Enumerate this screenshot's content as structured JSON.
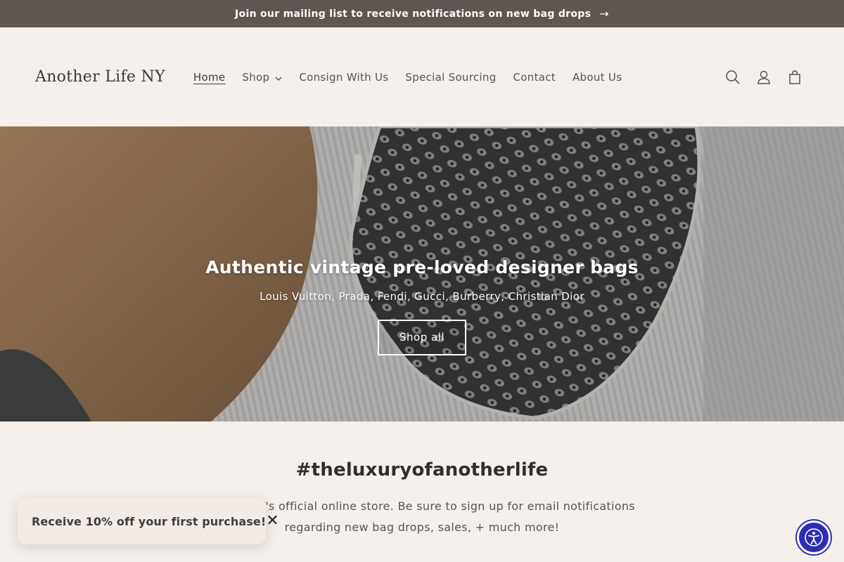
{
  "announcement": {
    "text": "Join our mailing list to receive notifications on new bag drops",
    "arrow": "→"
  },
  "header": {
    "logo": "Another Life NY",
    "nav": [
      {
        "label": "Home",
        "active": true
      },
      {
        "label": "Shop",
        "has_dropdown": true
      },
      {
        "label": "Consign With Us"
      },
      {
        "label": "Special Sourcing"
      },
      {
        "label": "Contact"
      },
      {
        "label": "About Us"
      }
    ],
    "icons": [
      "search-icon",
      "account-icon",
      "cart-icon"
    ]
  },
  "hero": {
    "title": "Authentic vintage pre-loved designer bags",
    "subtitle": "Louis Vuitton, Prada, Fendi, Gucci, Burberry, Christian Dior",
    "button": "Shop all"
  },
  "section": {
    "title": "#theluxuryofanotherlife",
    "text": "er Life NY's official online store. Be sure to sign up for email notifications regarding new bag drops, sales, + much more!"
  },
  "popup": {
    "text": "Receive 10% off your first purchase!",
    "close": "✕"
  },
  "colors": {
    "announcement_bg": "#5e5651",
    "page_bg": "#f6f0ec",
    "accessibility_button": "#2b2eb5"
  }
}
